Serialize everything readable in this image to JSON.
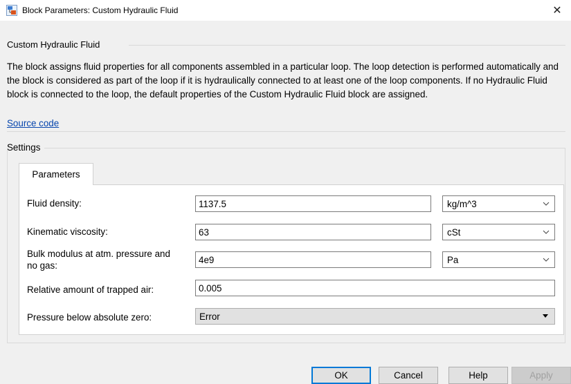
{
  "window": {
    "title": "Block Parameters: Custom Hydraulic Fluid",
    "icon": "simulink-block-icon",
    "close_glyph": "✕"
  },
  "block": {
    "name": "Custom Hydraulic Fluid",
    "description": "The block assigns fluid properties for all components assembled in a particular loop. The loop detection is performed automatically and the block is considered as part of the loop if it is hydraulically connected to at least one of the loop components. If no Hydraulic Fluid block is connected to the loop, the default properties of the Custom Hydraulic Fluid block are assigned.",
    "source_link": "Source code"
  },
  "settings": {
    "label": "Settings",
    "tab": "Parameters",
    "rows": [
      {
        "label": "Fluid density:",
        "value": "1137.5",
        "unit": "kg/m^3"
      },
      {
        "label": "Kinematic viscosity:",
        "value": "63",
        "unit": "cSt"
      },
      {
        "label": "Bulk modulus at atm. pressure and no gas:",
        "value": "4e9",
        "unit": "Pa"
      },
      {
        "label": "Relative amount of trapped air:",
        "value": "0.005"
      },
      {
        "label": "Pressure below absolute zero:",
        "value": "Error"
      }
    ]
  },
  "buttons": {
    "ok": "OK",
    "cancel": "Cancel",
    "help": "Help",
    "apply": "Apply"
  },
  "colors": {
    "link": "#0645ad",
    "focus_border": "#0078d7",
    "dialog_bg": "#f0f0f0"
  }
}
